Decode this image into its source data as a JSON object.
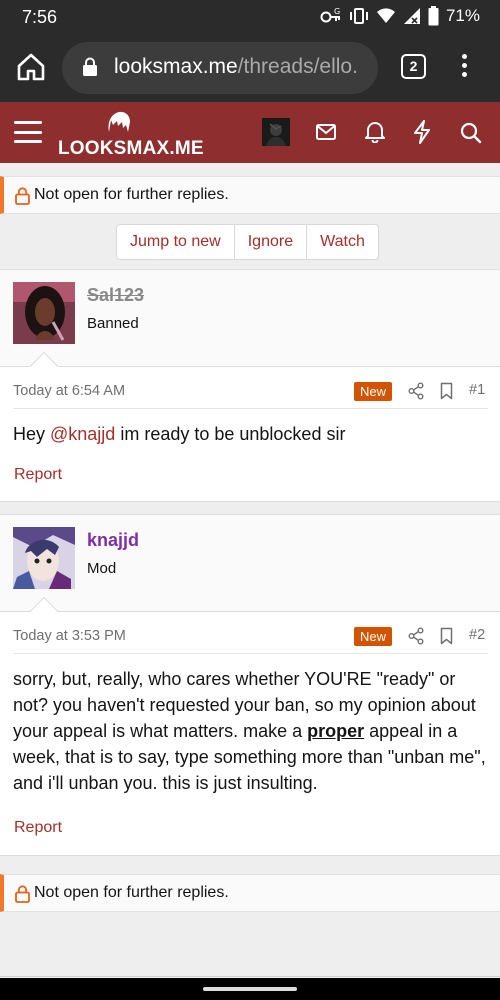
{
  "status_bar": {
    "time": "7:56",
    "battery": "71%",
    "icons": [
      "key-icon",
      "vibrate-icon",
      "wifi-icon",
      "signal-icon",
      "battery-icon"
    ]
  },
  "browser": {
    "url_host": "looksmax.me",
    "url_path": "/threads/ello.",
    "tab_count": "2"
  },
  "site": {
    "logo_text": "LOOKSMAX.ME",
    "header_icons": [
      "avatar",
      "mail-icon",
      "bell-icon",
      "bolt-icon",
      "search-icon"
    ],
    "brand_color": "#8f2e2e",
    "accent_color": "#a3302b"
  },
  "thread": {
    "notice_text": "Not open for further replies.",
    "buttons": [
      "Jump to new",
      "Ignore",
      "Watch"
    ],
    "posts": [
      {
        "username": "Sal123",
        "user_title": "Banned",
        "username_banned": true,
        "timestamp": "Today at 6:54 AM",
        "badge": "New",
        "number": "#1",
        "body_pre": "Hey ",
        "body_mention": "@knajjd",
        "body_post": " im ready to be unblocked sir",
        "report": "Report"
      },
      {
        "username": "knajjd",
        "user_title": "Mod",
        "username_color": "#7d2fa8",
        "timestamp": "Today at 3:53 PM",
        "badge": "New",
        "number": "#2",
        "body_pre": "sorry, but, really, who cares whether YOU'RE \"ready\" or not? you haven't requested your ban, so my opinion about your appeal is what matters. make a ",
        "body_emph": "proper",
        "body_post": " appeal in a week, that is to say, type something more than \"unban me\", and i'll unban you. this is just insulting.",
        "report": "Report"
      }
    ]
  }
}
